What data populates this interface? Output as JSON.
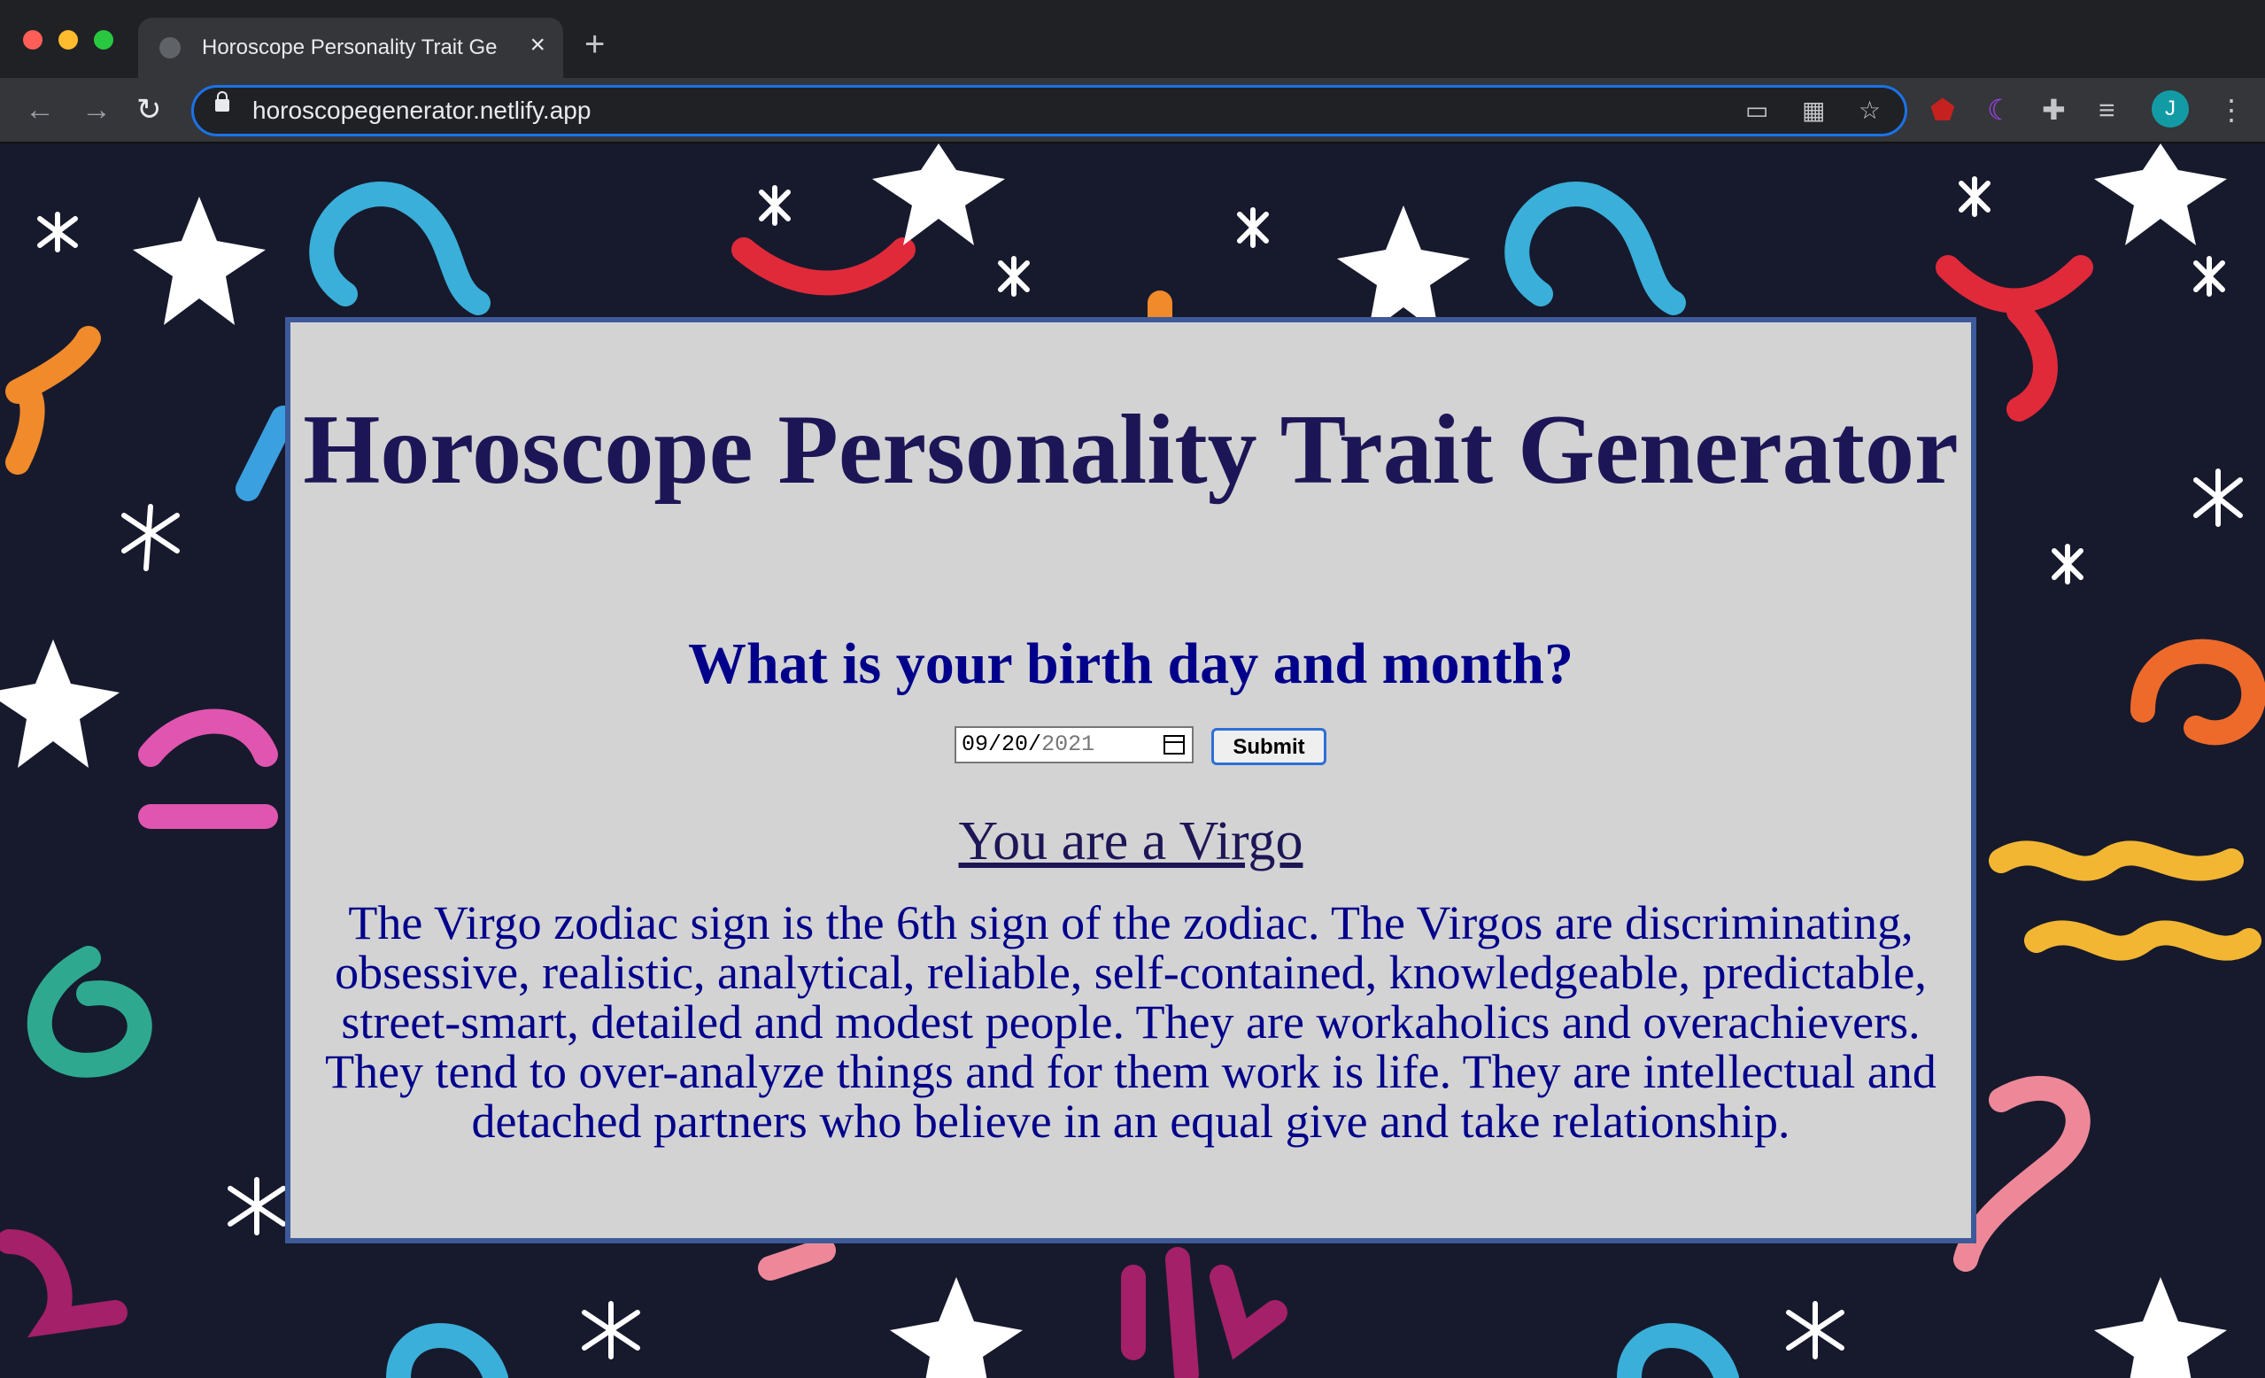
{
  "browser": {
    "tab_title": "Horoscope Personality Trait Ge",
    "url": "horoscopegenerator.netlify.app",
    "new_tab": "+",
    "profile_initial": "J",
    "icons": [
      "back-icon",
      "forward-icon",
      "reload-icon",
      "lock-icon",
      "cast-icon",
      "apps-icon",
      "star-icon",
      "ublock-icon",
      "moon-icon",
      "extensions-icon",
      "reading-list-icon",
      "menu-icon"
    ]
  },
  "page": {
    "title": "Horoscope Personality Trait Generator",
    "question": "What is your birth day and month?",
    "date_input": {
      "month": "09",
      "day": "20",
      "year": "2021",
      "separator": "/"
    },
    "submit_label": "Submit",
    "result_heading": "You are a Virgo",
    "result_description": "The Virgo zodiac sign is the 6th sign of the zodiac. The Virgos are discriminating, obsessive, realistic, analytical, reliable, self-contained, knowledgeable, predictable, street-smart, detailed and modest people. They are workaholics and overachievers. They tend to over-analyze things and for them work is life. They are intellectual and detached partners who believe in an equal give and take relationship."
  },
  "colors": {
    "background": "#171a2d",
    "card": "#d3d3d3",
    "card_border": "#3d5a99",
    "title": "#1d1656",
    "body_text": "#00008b",
    "accent_blue": "#1a73e8"
  }
}
